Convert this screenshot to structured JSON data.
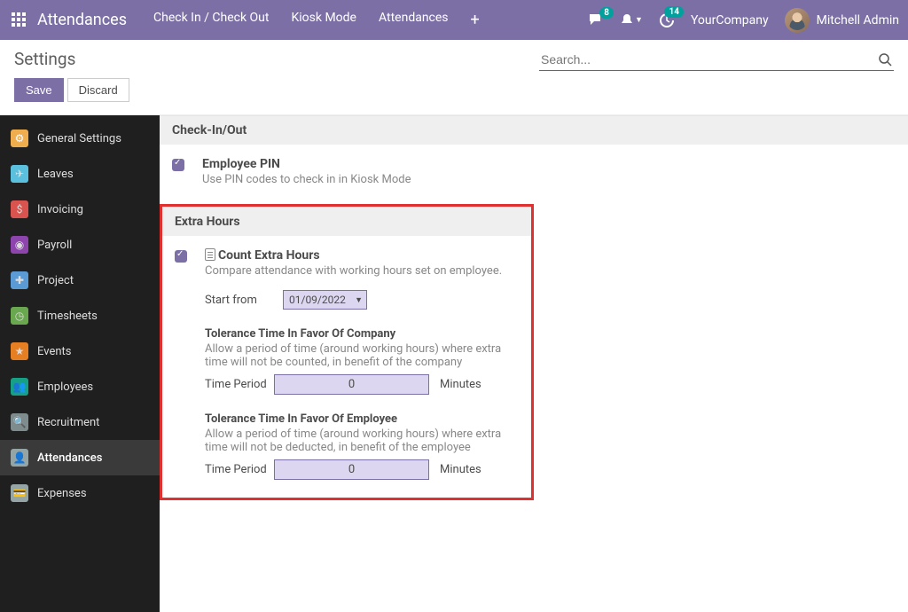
{
  "topbar": {
    "app_title": "Attendances",
    "nav": [
      "Check In / Check Out",
      "Kiosk Mode",
      "Attendances"
    ],
    "badges": {
      "messages": "8",
      "activities": "14"
    },
    "company": "YourCompany",
    "user": "Mitchell Admin"
  },
  "control": {
    "title": "Settings",
    "save": "Save",
    "discard": "Discard",
    "search_placeholder": "Search..."
  },
  "sidebar": {
    "items": [
      {
        "label": "General Settings"
      },
      {
        "label": "Leaves"
      },
      {
        "label": "Invoicing"
      },
      {
        "label": "Payroll"
      },
      {
        "label": "Project"
      },
      {
        "label": "Timesheets"
      },
      {
        "label": "Events"
      },
      {
        "label": "Employees"
      },
      {
        "label": "Recruitment"
      },
      {
        "label": "Attendances"
      },
      {
        "label": "Expenses"
      }
    ]
  },
  "sections": {
    "checkin": {
      "header": "Check-In/Out",
      "pin_title": "Employee PIN",
      "pin_desc": "Use PIN codes to check in in Kiosk Mode"
    },
    "extra": {
      "header": "Extra Hours",
      "count_title": "Count Extra Hours",
      "count_desc": "Compare attendance with working hours set on employee.",
      "start_label": "Start from",
      "start_value": "01/09/2022",
      "company_title": "Tolerance Time In Favor Of Company",
      "company_desc": "Allow a period of time (around working hours) where extra time will not be counted, in benefit of the company",
      "employee_title": "Tolerance Time In Favor Of Employee",
      "employee_desc": "Allow a period of time (around working hours) where extra time will not be deducted, in benefit of the employee",
      "time_label": "Time Period",
      "company_value": "0",
      "employee_value": "0",
      "unit": "Minutes"
    }
  }
}
